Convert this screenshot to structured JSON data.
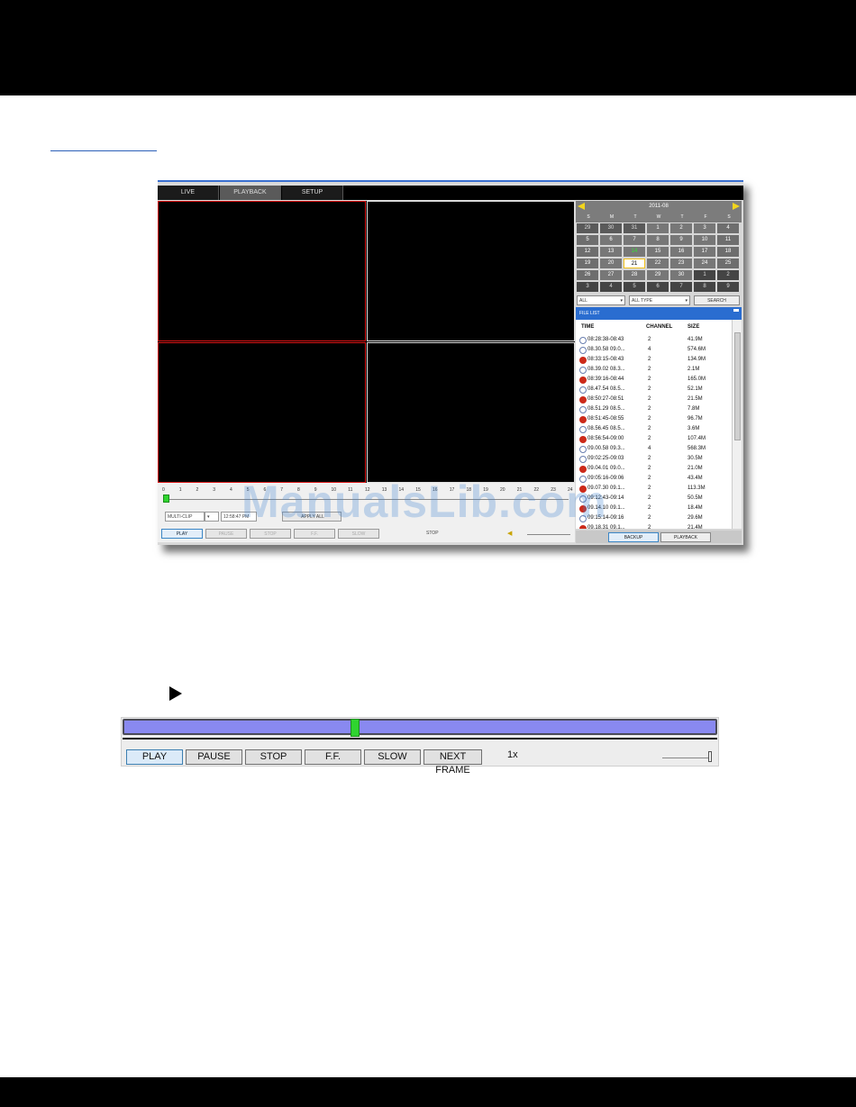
{
  "tabs": [
    "LIVE",
    "PLAYBACK",
    "SETUP"
  ],
  "timeline": {
    "hours": [
      "0",
      "1",
      "2",
      "3",
      "4",
      "5",
      "6",
      "7",
      "8",
      "9",
      "10",
      "11",
      "12",
      "13",
      "14",
      "15",
      "16",
      "17",
      "18",
      "19",
      "20",
      "21",
      "22",
      "23",
      "24"
    ]
  },
  "playback_small": {
    "multi_clip": "MULTI-CLIP",
    "time_field": "12:58:47 PM",
    "apply": "APPLY ALL",
    "buttons": [
      "PLAY",
      "PAUSE",
      "STOP",
      "F.F.",
      "SLOW"
    ],
    "status": "STOP"
  },
  "calendar": {
    "title": "2011-08",
    "weekdays": [
      "S",
      "M",
      "T",
      "W",
      "T",
      "F",
      "S"
    ],
    "days": [
      "29",
      "30",
      "31",
      "1",
      "2",
      "3",
      "4",
      "5",
      "6",
      "7",
      "8",
      "9",
      "10",
      "11",
      "12",
      "13",
      "14",
      "15",
      "16",
      "17",
      "18",
      "19",
      "20",
      "21",
      "22",
      "23",
      "24",
      "25",
      "26",
      "27",
      "28",
      "29",
      "30",
      "1",
      "2",
      "3",
      "4",
      "5",
      "6",
      "7",
      "8",
      "9"
    ]
  },
  "filters": {
    "channel": "ALL",
    "type": "ALL TYPE",
    "search": "SEARCH"
  },
  "file_list": {
    "title": "FILE LIST",
    "columns": {
      "time": "TIME",
      "channel": "CHANNEL",
      "size": "SIZE"
    },
    "rows": [
      {
        "type": "normal",
        "time": "08:28:38-08:43",
        "channel": "2",
        "size": "41.9M"
      },
      {
        "type": "normal",
        "time": "08.30.58 09.0...",
        "channel": "4",
        "size": "574.6M"
      },
      {
        "type": "alarm",
        "time": "08:33:15-08:43",
        "channel": "2",
        "size": "134.9M"
      },
      {
        "type": "normal",
        "time": "08.39.02 08.3...",
        "channel": "2",
        "size": "2.1M"
      },
      {
        "type": "alarm",
        "time": "08:39:16-08:44",
        "channel": "2",
        "size": "165.0M"
      },
      {
        "type": "normal",
        "time": "08.47.54 08.5...",
        "channel": "2",
        "size": "52.1M"
      },
      {
        "type": "alarm",
        "time": "08:50:27-08:51",
        "channel": "2",
        "size": "21.5M"
      },
      {
        "type": "normal",
        "time": "08.51.29 08.5...",
        "channel": "2",
        "size": "7.8M"
      },
      {
        "type": "alarm",
        "time": "08:51:45-08:55",
        "channel": "2",
        "size": "96.7M"
      },
      {
        "type": "normal",
        "time": "08.56.45 08.5...",
        "channel": "2",
        "size": "3.6M"
      },
      {
        "type": "alarm",
        "time": "08:56:54-09:00",
        "channel": "2",
        "size": "107.4M"
      },
      {
        "type": "normal",
        "time": "09.00.58 09.3...",
        "channel": "4",
        "size": "568.3M"
      },
      {
        "type": "normal",
        "time": "09:02:25-09:03",
        "channel": "2",
        "size": "30.5M"
      },
      {
        "type": "alarm",
        "time": "09.04.01 09.0...",
        "channel": "2",
        "size": "21.0M"
      },
      {
        "type": "normal",
        "time": "09:05:16-09:06",
        "channel": "2",
        "size": "43.4M"
      },
      {
        "type": "alarm",
        "time": "09.07.30 09.1...",
        "channel": "2",
        "size": "113.3M"
      },
      {
        "type": "normal",
        "time": "09:12:43-09:14",
        "channel": "2",
        "size": "50.5M"
      },
      {
        "type": "alarm",
        "time": "09.14.10 09.1...",
        "channel": "2",
        "size": "18.4M"
      },
      {
        "type": "normal",
        "time": "09:15:14-09:16",
        "channel": "2",
        "size": "29.6M"
      },
      {
        "type": "alarm",
        "time": "09.18.31 09.1...",
        "channel": "2",
        "size": "21.4M"
      }
    ],
    "backup": "BACKUP",
    "playback": "PLAYBACK"
  },
  "watermark": "ManualsLib.com",
  "controls": {
    "buttons": [
      "PLAY",
      "PAUSE",
      "STOP",
      "F.F.",
      "SLOW",
      "NEXT FRAME"
    ],
    "speed": "1x",
    "progress": 0.39
  },
  "colors": {
    "accent_blue": "#2a6dd0",
    "progress_bar": "#8989f0",
    "progress_knob": "#2fd42f",
    "selected_cell_border": "#d91414",
    "calendar_arrow": "#f2d51d"
  }
}
